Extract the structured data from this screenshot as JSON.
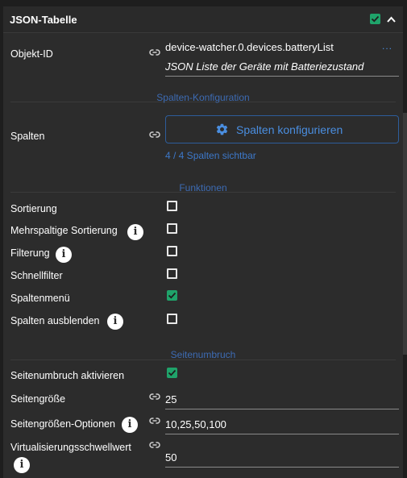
{
  "header": {
    "title": "JSON-Tabelle",
    "enabled": true
  },
  "object_id": {
    "label": "Objekt-ID",
    "value": "device-watcher.0.devices.batteryList",
    "description": "JSON Liste der Geräte mit Batteriezustand",
    "more": "..."
  },
  "columns_section": {
    "heading": "Spalten-Konfiguration",
    "columns_label": "Spalten",
    "configure_button": "Spalten konfigurieren",
    "visible_info": "4 / 4 Spalten sichtbar"
  },
  "functions_section": {
    "heading": "Funktionen",
    "items": [
      {
        "label": "Sortierung",
        "checked": false,
        "info": false
      },
      {
        "label": "Mehrspaltige Sortierung",
        "checked": false,
        "info": true
      },
      {
        "label": "Filterung",
        "checked": false,
        "info": true
      },
      {
        "label": "Schnellfilter",
        "checked": false,
        "info": false
      },
      {
        "label": "Spaltenmenü",
        "checked": true,
        "info": false
      },
      {
        "label": "Spalten ausblenden",
        "checked": false,
        "info": true
      }
    ]
  },
  "pagination_section": {
    "heading": "Seitenumbruch",
    "enable_label": "Seitenumbruch aktivieren",
    "enable_checked": true,
    "page_size_label": "Seitengröße",
    "page_size_value": "25",
    "page_size_options_label": "Seitengrößen-Optionen",
    "page_size_options_value": "10,25,50,100",
    "virtualization_label": "Virtualisierungsschwellwert",
    "virtualization_value": "50"
  },
  "colors": {
    "accent": "#4a8ee0",
    "section_heading": "#3d6bb3",
    "checkbox_on": "#1fa36a",
    "panel_bg": "#2c2c2c"
  }
}
